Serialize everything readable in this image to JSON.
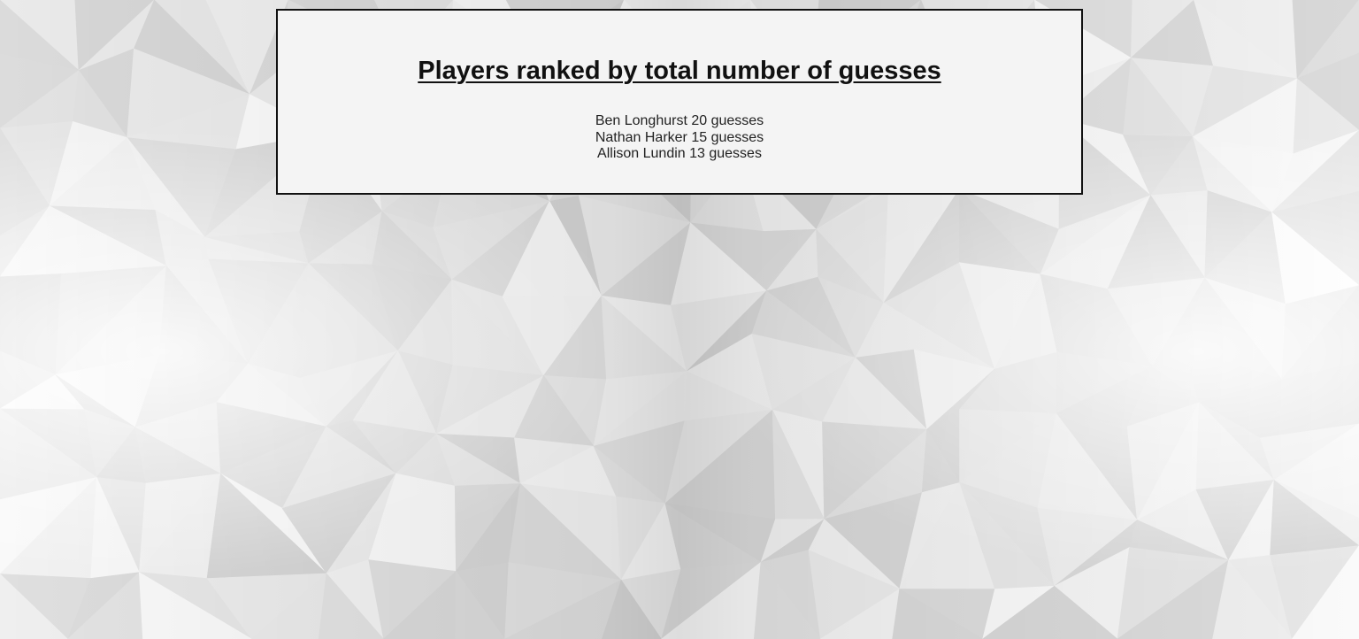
{
  "leaderboard": {
    "title": "Players ranked by total number of guesses",
    "players": [
      {
        "name": "Ben Longhurst",
        "guesses": 20,
        "text": "Ben Longhurst 20 guesses"
      },
      {
        "name": "Nathan Harker",
        "guesses": 15,
        "text": "Nathan Harker 15 guesses"
      },
      {
        "name": "Allison Lundin",
        "guesses": 13,
        "text": "Allison Lundin 13 guesses"
      }
    ]
  },
  "colors": {
    "panel_background": "#f4f4f4",
    "panel_border": "#111111",
    "text": "#111111",
    "page_background": "#ececec"
  }
}
